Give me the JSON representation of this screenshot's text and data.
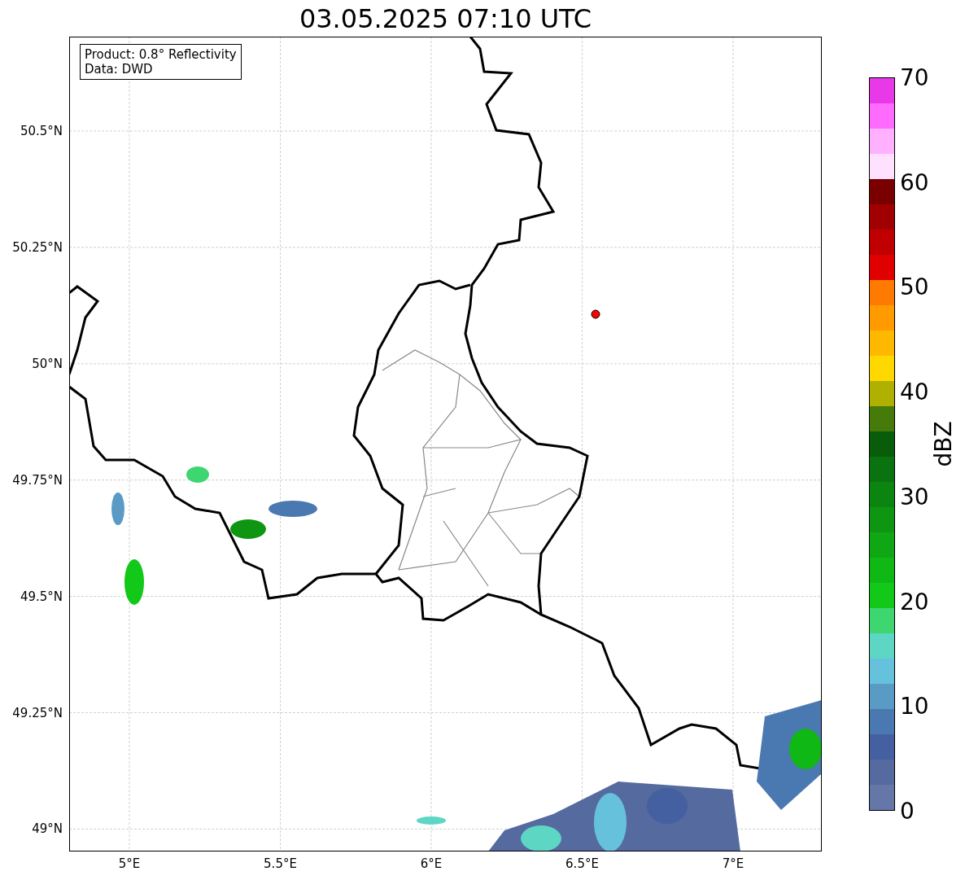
{
  "title": "03.05.2025 07:10 UTC",
  "info_box": [
    "Product: 0.8° Reflectivity",
    "Data: DWD"
  ],
  "map": {
    "y_ticks": [
      "50.5°N",
      "50.25°N",
      "50°N",
      "49.75°N",
      "49.5°N",
      "49.25°N",
      "49°N"
    ],
    "x_ticks": [
      "5°E",
      "5.5°E",
      "6°E",
      "6.5°E",
      "7°E"
    ]
  },
  "colorbar": {
    "label": "dBZ",
    "ticks": [
      "70",
      "60",
      "50",
      "40",
      "30",
      "20",
      "10",
      "0"
    ],
    "bins": [
      {
        "color": "#e838e8"
      },
      {
        "color": "#ff6aff"
      },
      {
        "color": "#ffb0ff"
      },
      {
        "color": "#ffe0ff"
      },
      {
        "color": "#7a0000"
      },
      {
        "color": "#a00000"
      },
      {
        "color": "#c00000"
      },
      {
        "color": "#e00000"
      },
      {
        "color": "#ff7a00"
      },
      {
        "color": "#ff9a00"
      },
      {
        "color": "#ffb800"
      },
      {
        "color": "#ffd800"
      },
      {
        "color": "#b0b000"
      },
      {
        "color": "#467a0a"
      },
      {
        "color": "#085c0a"
      },
      {
        "color": "#0a720e"
      },
      {
        "color": "#0b8410"
      },
      {
        "color": "#0e9612"
      },
      {
        "color": "#0fa814"
      },
      {
        "color": "#10b816"
      },
      {
        "color": "#12c818"
      },
      {
        "color": "#3dd670"
      },
      {
        "color": "#5ed6c4"
      },
      {
        "color": "#66c2dc"
      },
      {
        "color": "#5a9bc6"
      },
      {
        "color": "#4a78b0"
      },
      {
        "color": "#4560a0"
      },
      {
        "color": "#556a9e"
      },
      {
        "color": "#6577a8"
      }
    ]
  }
}
